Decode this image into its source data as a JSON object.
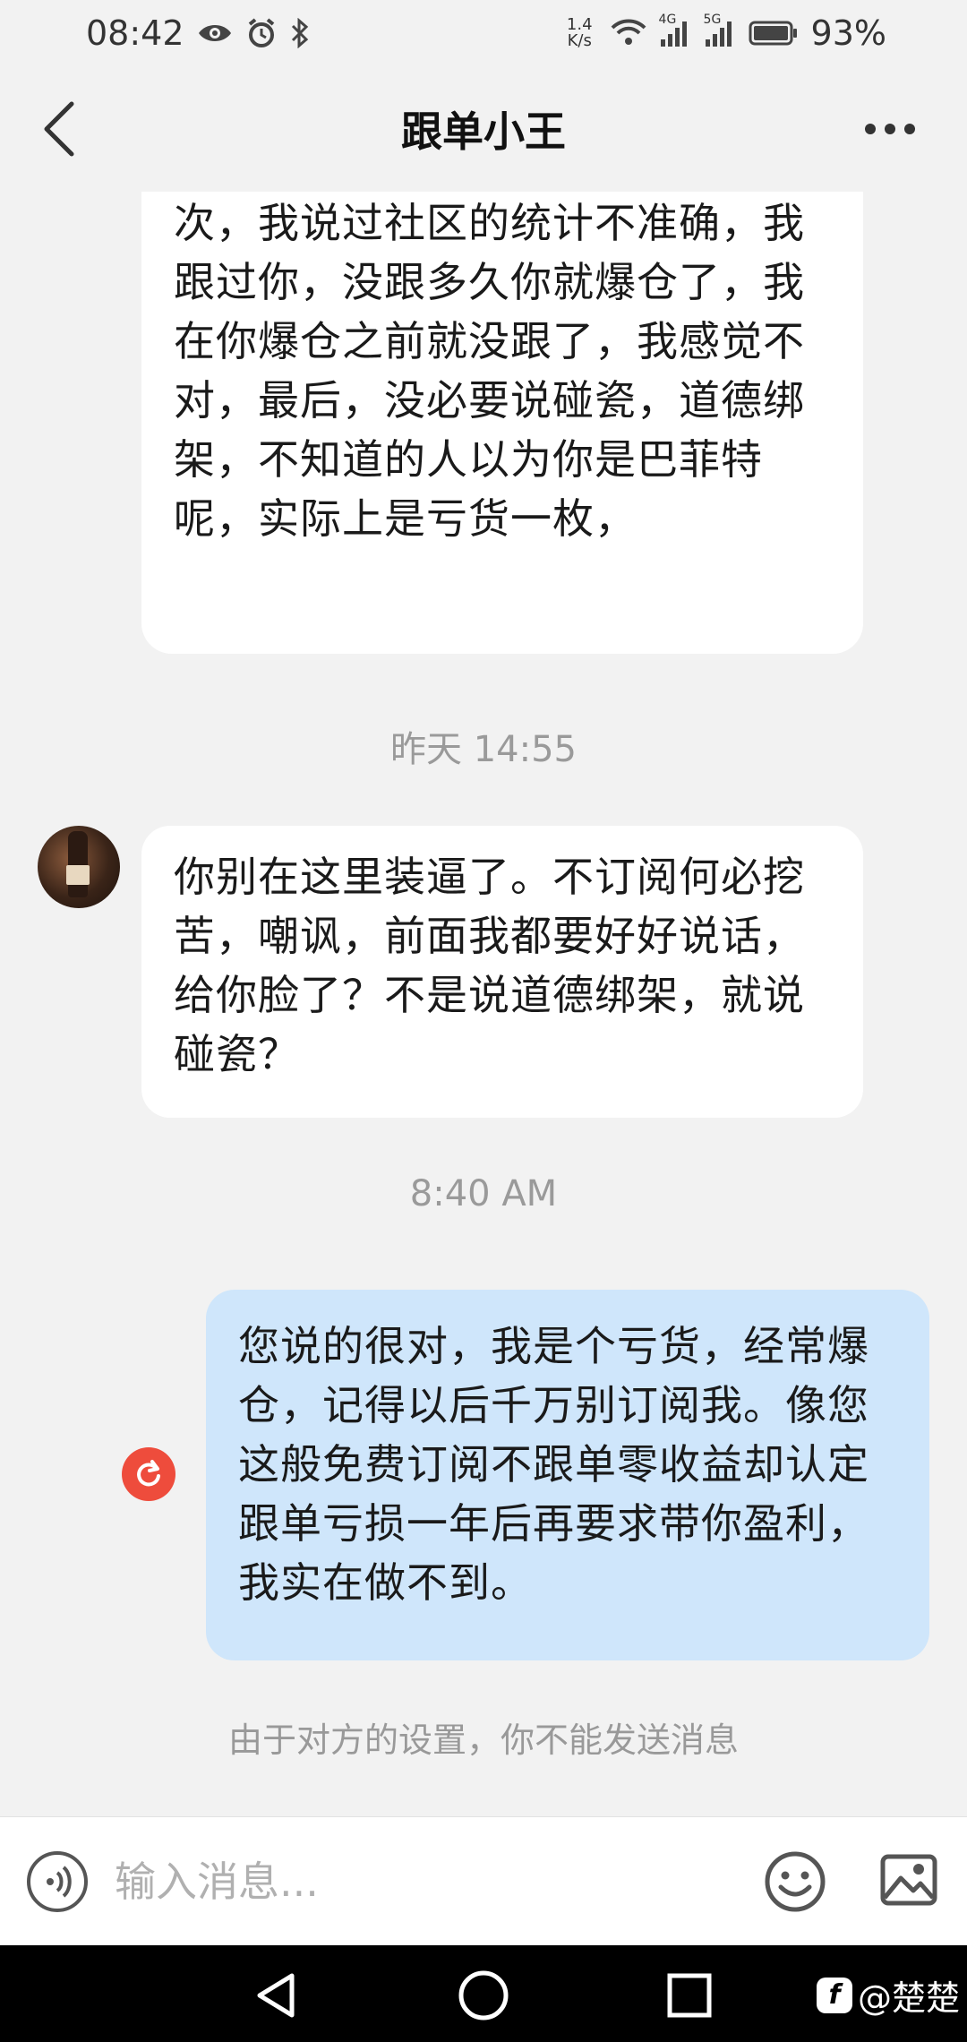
{
  "status_bar": {
    "time": "08:42",
    "net_speed_value": "1.4",
    "net_speed_unit": "K/s",
    "signal_1": "4G",
    "signal_2": "5G",
    "battery": "93%"
  },
  "header": {
    "title": "跟单小王"
  },
  "messages": [
    {
      "sender": "other",
      "text": "次，我说过社区的统计不准确，我跟过你，没跟多久你就爆仓了，我在你爆仓之前就没跟了，我感觉不对，最后，没必要说碰瓷，道德绑架，不知道的人以为你是巴菲特呢，实际上是亏货一枚，"
    },
    {
      "timestamp": "昨天 14:55"
    },
    {
      "sender": "other",
      "text": "你别在这里装逼了。不订阅何必挖苦，嘲讽，前面我都要好好说话，给你脸了？不是说道德绑架，就说碰瓷？"
    },
    {
      "timestamp": "8:40 AM"
    },
    {
      "sender": "self",
      "status": "failed",
      "text": "您说的很对，我是个亏货，经常爆仓，记得以后千万别订阅我。像您这般免费订阅不跟单零收益却认定跟单亏损一年后再要求带你盈利，我实在做不到。"
    }
  ],
  "notice": "由于对方的设置，你不能发送消息",
  "input": {
    "placeholder": "输入消息..."
  },
  "watermark": {
    "text": "@楚楚"
  },
  "icons": [
    "back-arrow-icon",
    "more-icon",
    "voice-icon",
    "emoji-icon",
    "image-icon",
    "resend-icon",
    "nav-back-icon",
    "nav-home-icon",
    "nav-recents-icon"
  ],
  "colors": {
    "self_bubble": "#cfe6fb",
    "other_bubble": "#ffffff",
    "background": "#f2f2f2",
    "error_red": "#ee4c3c"
  }
}
